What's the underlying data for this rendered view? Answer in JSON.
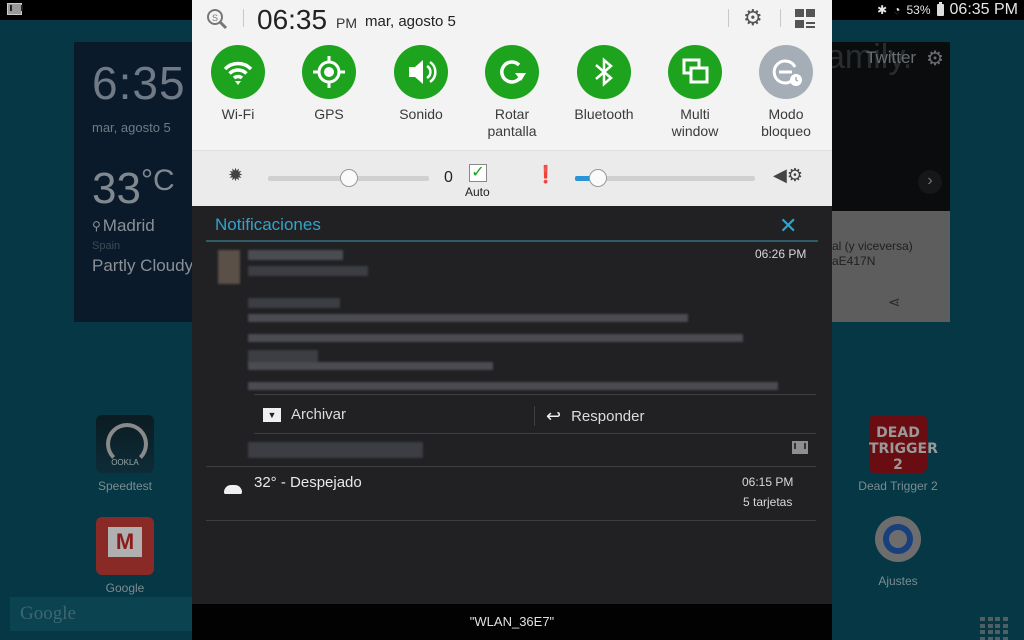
{
  "status_bar": {
    "left_icon": "gmail-notification-icon",
    "battery": "53%",
    "time": "06:35 PM"
  },
  "home": {
    "clock_widget": {
      "time": "6:35",
      "date": "mar, agosto 5",
      "temperature": "33",
      "unit": "°C",
      "city": "Madrid",
      "country": "Spain",
      "condition": "Partly Cloudy"
    },
    "twitter_widget": {
      "bg_text": "amily.",
      "title": "Twitter",
      "card_text_1": "al (y viceversa)",
      "card_text_2": "aE417N"
    },
    "apps": [
      {
        "label": "Speedtest",
        "icon_text": "OOKLA"
      },
      {
        "label": "Google"
      },
      {
        "label": "Dead Trigger 2",
        "icon_text": "DEAD TRIGGER 2"
      },
      {
        "label": "Ajustes"
      }
    ],
    "search_placeholder": "Google"
  },
  "quick_settings": {
    "time": "06:35",
    "ampm": "PM",
    "date": "mar, agosto 5",
    "toggles": [
      {
        "label": "Wi-Fi",
        "icon": "wifi-icon",
        "on": true
      },
      {
        "label": "GPS",
        "icon": "gps-icon",
        "on": true
      },
      {
        "label": "Sonido",
        "icon": "sound-icon",
        "on": true
      },
      {
        "label": "Rotar pantalla",
        "line1": "Rotar",
        "line2": "pantalla",
        "icon": "rotate-icon",
        "on": true
      },
      {
        "label": "Bluetooth",
        "icon": "bluetooth-icon",
        "on": true
      },
      {
        "label": "Multi window",
        "line1": "Multi",
        "line2": "window",
        "icon": "multi-window-icon",
        "on": true
      },
      {
        "label": "Modo bloqueo",
        "line1": "Modo",
        "line2": "bloqueo",
        "icon": "blocking-mode-icon",
        "on": false
      }
    ],
    "brightness": {
      "value": "0",
      "level_fraction": 0.5,
      "auto_label": "Auto",
      "auto_checked": true
    },
    "notification_volume": {
      "level_fraction": 0.13
    }
  },
  "notifications": {
    "title": "Notificaciones",
    "items": [
      {
        "time": "06:26 PM",
        "actions": [
          "Archivar",
          "Responder"
        ]
      },
      {
        "text": "32° - Despejado",
        "time": "06:15 PM",
        "sub": "5 tarjetas"
      }
    ]
  },
  "carrier": "\"WLAN_36E7\"",
  "colors": {
    "toggle_on": "#1ea31e",
    "toggle_off": "#a5aeb6",
    "accent": "#32a3cb",
    "slider_fill": "#2a94d6"
  }
}
